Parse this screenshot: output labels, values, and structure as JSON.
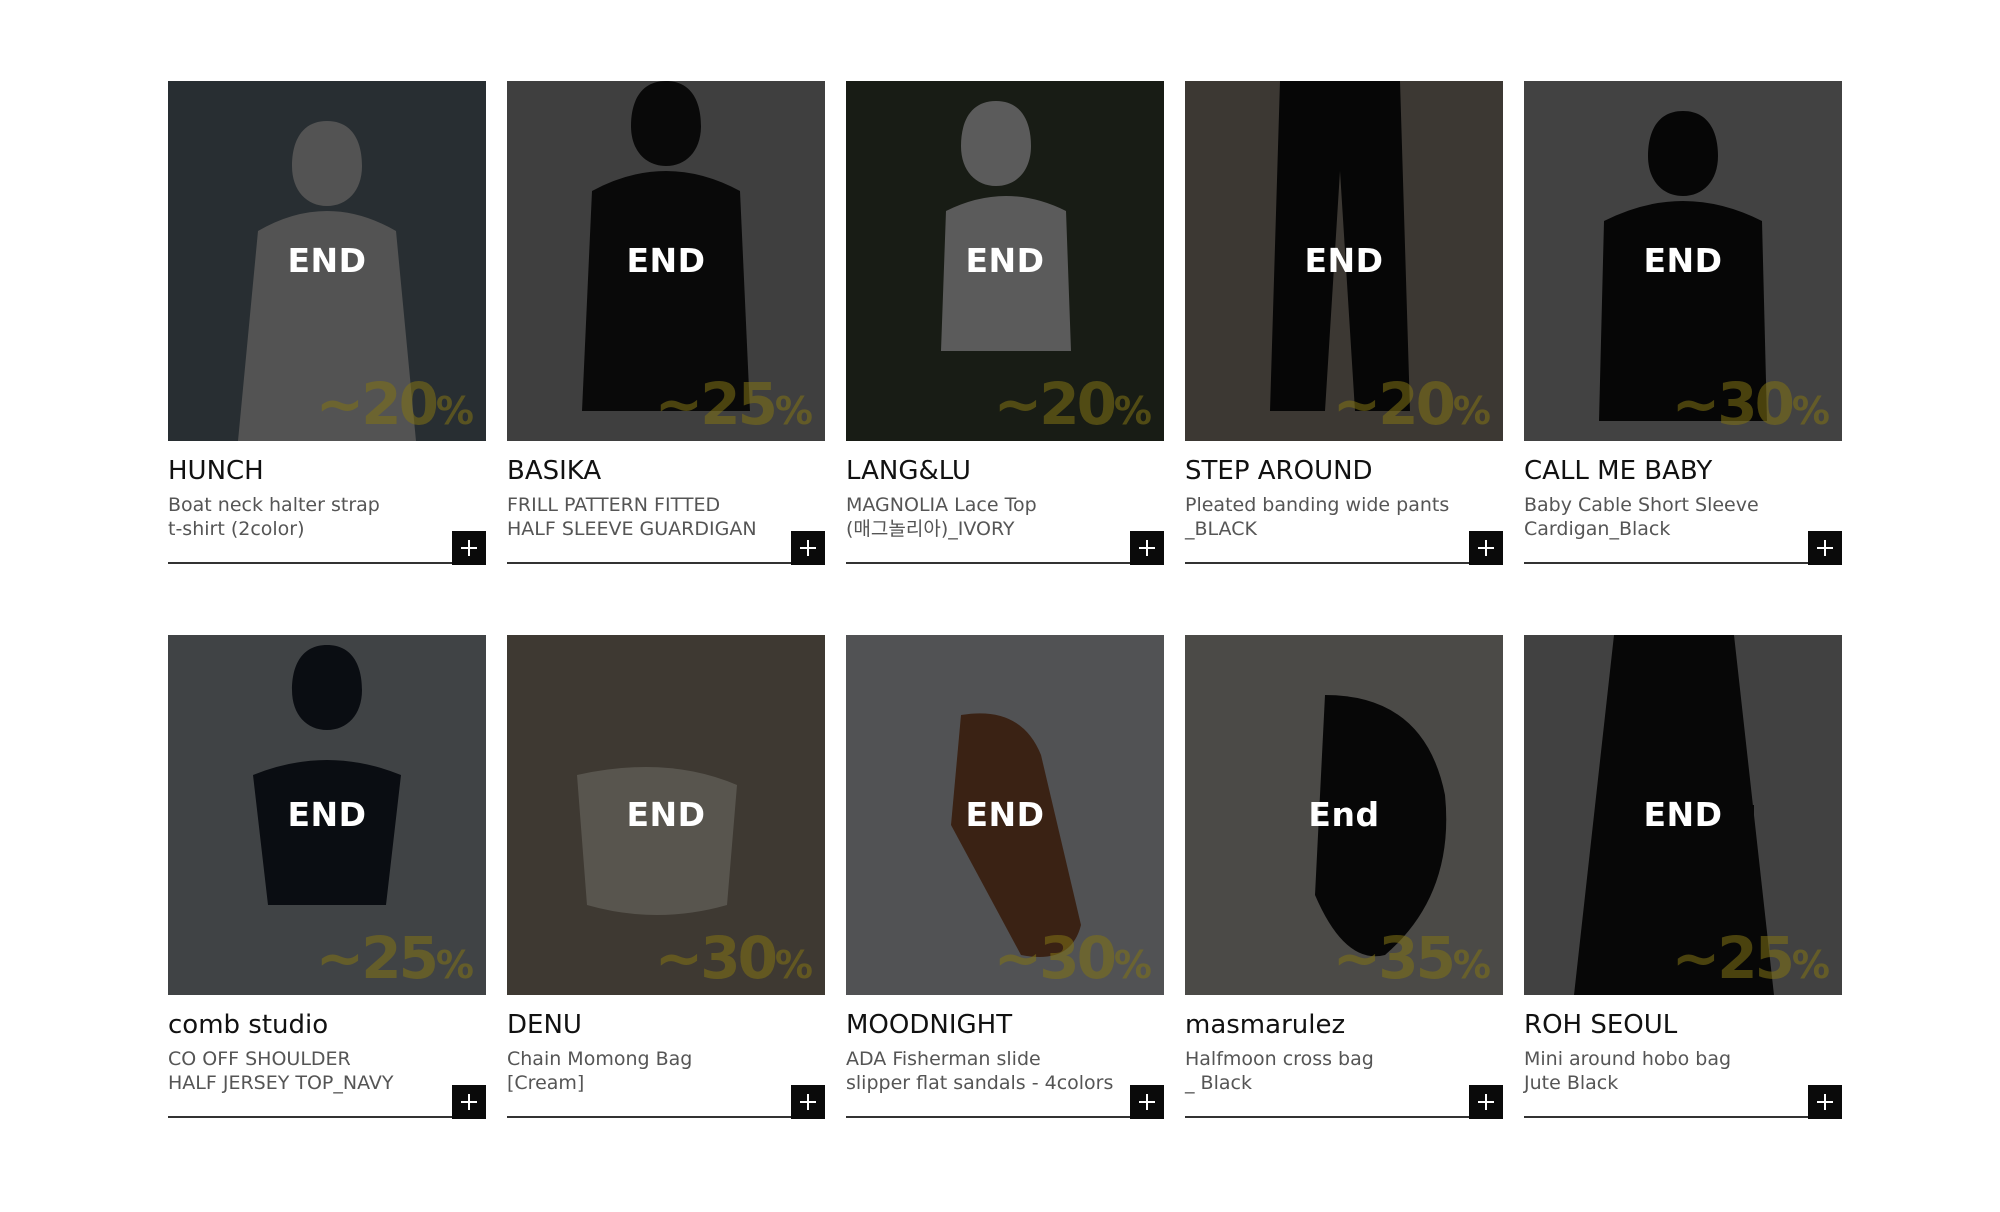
{
  "products": [
    {
      "brand": "HUNCH",
      "line1": "Boat neck halter strap",
      "line2": "t-shirt (2color)",
      "status": "END",
      "discount": "~20",
      "pct": "%",
      "tone": [
        "#4b5a66",
        "#8a97a0",
        "#d9d9d9"
      ]
    },
    {
      "brand": "BASIKA",
      "line1": "FRILL PATTERN FITTED",
      "line2": "HALF SLEEVE GUARDIGAN",
      "status": "END",
      "discount": "~25",
      "pct": "%",
      "tone": [
        "#8d8d8d",
        "#bdbdbd",
        "#1a1a1a"
      ]
    },
    {
      "brand": "LANG&LU",
      "line1": "MAGNOLIA Lace Top",
      "line2": "(매그놀리아)_IVORY",
      "status": "END",
      "discount": "~20",
      "pct": "%",
      "tone": [
        "#2d3526",
        "#56604a",
        "#eeeeee"
      ]
    },
    {
      "brand": "STEP AROUND",
      "line1": "Pleated banding wide pants",
      "line2": "_BLACK",
      "status": "END",
      "discount": "~20",
      "pct": "%",
      "tone": [
        "#b0a598",
        "#8c8276",
        "#111111"
      ]
    },
    {
      "brand": "CALL ME BABY",
      "line1": "Baby Cable Short Sleeve",
      "line2": "Cardigan_Black",
      "status": "END",
      "discount": "~30",
      "pct": "%",
      "tone": [
        "#9c9c9c",
        "#c2c2c2",
        "#121212"
      ]
    },
    {
      "brand": "comb studio",
      "line1": "CO OFF SHOULDER",
      "line2": "HALF JERSEY TOP_NAVY",
      "status": "END",
      "discount": "~25",
      "pct": "%",
      "tone": [
        "#9aa3a8",
        "#b8bfc3",
        "#1b2230"
      ]
    },
    {
      "brand": "DENU",
      "line1": "Chain Momong Bag",
      "line2": "[Cream]",
      "status": "END",
      "discount": "~30",
      "pct": "%",
      "tone": [
        "#8d8172",
        "#b8ab95",
        "#e8e0cc"
      ]
    },
    {
      "brand": "MOODNIGHT",
      "line1": "ADA Fisherman slide",
      "line2": "slipper flat sandals - 4colors",
      "status": "END",
      "discount": "~30",
      "pct": "%",
      "tone": [
        "#c9ccd2",
        "#e2e4e8",
        "#9a5a35"
      ]
    },
    {
      "brand": "masmarulez",
      "line1": "Halfmoon cross bag",
      "line2": "_ Black",
      "status": "End",
      "discount": "~35",
      "pct": "%",
      "tone": [
        "#b7b3ac",
        "#d6d2cc",
        "#141414"
      ]
    },
    {
      "brand": "ROH SEOUL",
      "line1": "Mini around hobo bag",
      "line2": "Jute Black",
      "status": "END",
      "discount": "~25",
      "pct": "%",
      "tone": [
        "#9c9c9c",
        "#bcbcbc",
        "#141414"
      ]
    }
  ],
  "add_button_icon": "plus-icon"
}
